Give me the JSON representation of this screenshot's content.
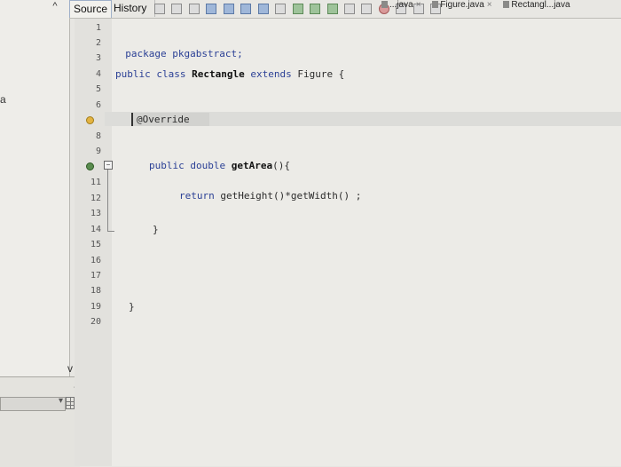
{
  "left_panel": {
    "scroll_up": "^",
    "letter": "a",
    "scroll_down": "v",
    "collapse": "-"
  },
  "file_tabs": [
    {
      "label": "...java",
      "close": "×"
    },
    {
      "label": "Figure.java",
      "close": "×"
    },
    {
      "label": "Rectangl...java",
      "close": ""
    }
  ],
  "toolbar": {
    "source_tab": "Source",
    "history_tab": "History"
  },
  "line_numbers": [
    "1",
    "2",
    "3",
    "4",
    "5",
    "6",
    "",
    "8",
    "9",
    "",
    "11",
    "12",
    "13",
    "14",
    "15",
    "16",
    "17",
    "18",
    "19",
    "20"
  ],
  "code": {
    "line2": "package pkgabstract;",
    "line4_kw": "public class",
    "line4_name": "Rectangle",
    "line4_ext": "extends",
    "line4_rest": "Figure {",
    "line7": "@Override",
    "line10_kw": "public double",
    "line10_name": "getArea",
    "line10_rest": "(){",
    "line12_kw": "return",
    "line12_rest": "getHeight()*getWidth() ;",
    "line14": "}",
    "line19": "}"
  },
  "colors": {
    "keyword": "#2a3f95",
    "warning_marker": "#e3b341",
    "override_marker": "#5a8c4f"
  }
}
